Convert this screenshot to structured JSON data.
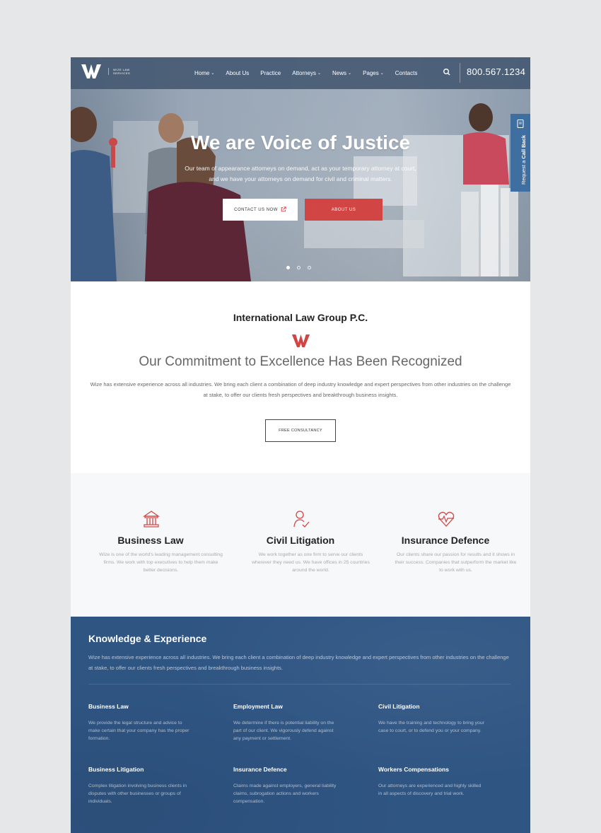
{
  "header": {
    "logo_text": "WIZE LAW SERVICES",
    "nav": [
      {
        "label": "Home",
        "dropdown": true
      },
      {
        "label": "About Us",
        "dropdown": false
      },
      {
        "label": "Practice",
        "dropdown": false
      },
      {
        "label": "Attorneys",
        "dropdown": true
      },
      {
        "label": "News",
        "dropdown": true
      },
      {
        "label": "Pages",
        "dropdown": true
      },
      {
        "label": "Contacts",
        "dropdown": false
      }
    ],
    "phone": "800.567.1234"
  },
  "hero": {
    "title": "We are Voice of Justice",
    "subtitle": "Our team of appearance attorneys on demand, act as your temporary attorney at court, and we have your attorneys on demand for civil and criminal matters.",
    "contact_label": "CONTACT US NOW",
    "about_label": "ABOUT US",
    "slides": 3,
    "active_slide": 1
  },
  "callback": {
    "prefix": "Request a",
    "label": "Call Back"
  },
  "intro": {
    "heading": "International Law Group P.C.",
    "title": "Our Commitment to Excellence Has Been Recognized",
    "description": "Wize has extensive experience across all industries. We bring each client a combination of deep industry knowledge and expert perspectives from other industries on the challenge at stake, to offer our clients fresh perspectives and breakthrough business insights.",
    "button_label": "FREE CONSULTANCY"
  },
  "services": [
    {
      "icon": "bank-icon",
      "title": "Business Law",
      "description": "Wize is one of the world's leading management consulting firms. We work with top executives to help them make better decisions."
    },
    {
      "icon": "person-check-icon",
      "title": "Civil Litigation",
      "description": "We work together as one firm to serve our clients wherever they need us. We have offices in 25 countries around the world."
    },
    {
      "icon": "heart-pulse-icon",
      "title": "Insurance Defence",
      "description": "Our clients share our passion for results and it shows in their success. Companies that outperform the market like to work with us."
    }
  ],
  "knowledge": {
    "title": "Knowledge & Experience",
    "description": "Wize has extensive experience across all industries. We bring each client a combination of deep industry knowledge and expert perspectives from other industries on the challenge at stake, to offer our clients fresh perspectives and breakthrough business insights.",
    "items": [
      {
        "title": "Business Law",
        "description": "We provide the legal structure and advice to make certain that your company has the proper formation."
      },
      {
        "title": "Employment Law",
        "description": "We determine if there is potential liability on the part of our client. We vigorously defend against any payment or settlement."
      },
      {
        "title": "Civil Litigation",
        "description": "We have the training and technology to bring your case to court, or to defend you or your company."
      },
      {
        "title": "Business Litigation",
        "description": "Complex litigation involving business clients in disputes with other businesses or groups of individuals."
      },
      {
        "title": "Insurance Defence",
        "description": "Claims made against employers, general liability claims, subrogation actions and workers compensation."
      },
      {
        "title": "Workers Compensations",
        "description": "Our attorneys are experienced and highly skilled in all aspects of discovery and trial work."
      }
    ]
  },
  "colors": {
    "accent": "#d14545",
    "header": "#465a73",
    "knowledge_bg": "#2f5583",
    "callback": "#3f6ea1"
  }
}
